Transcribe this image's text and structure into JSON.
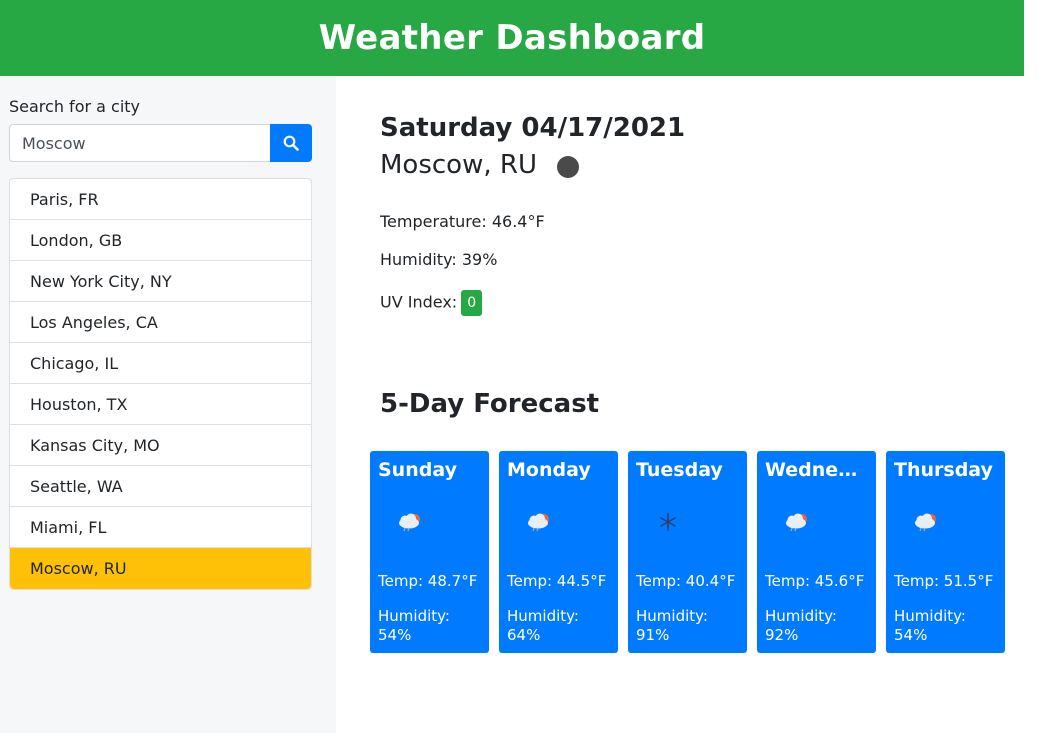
{
  "header": {
    "title": "Weather Dashboard"
  },
  "sidebar": {
    "search_label": "Search for a city",
    "search_value": "Moscow",
    "search_icon": "search-icon",
    "cities": [
      {
        "label": "Paris, FR",
        "active": false
      },
      {
        "label": "London, GB",
        "active": false
      },
      {
        "label": "New York City, NY",
        "active": false
      },
      {
        "label": "Los Angeles, CA",
        "active": false
      },
      {
        "label": "Chicago, IL",
        "active": false
      },
      {
        "label": "Houston, TX",
        "active": false
      },
      {
        "label": "Kansas City, MO",
        "active": false
      },
      {
        "label": "Seattle, WA",
        "active": false
      },
      {
        "label": "Miami, FL",
        "active": false
      },
      {
        "label": "Moscow, RU",
        "active": true
      }
    ]
  },
  "current": {
    "date": "Saturday 04/17/2021",
    "city": "Moscow, RU",
    "weather_icon": "weather-condition-icon",
    "temperature": "Temperature: 46.4°F",
    "humidity": "Humidity: 39%",
    "uv_label": "UV Index:",
    "uv_value": "0"
  },
  "forecast": {
    "title": "5-Day Forecast",
    "days": [
      {
        "day": "Sunday",
        "icon": "cloud-rain-sun-icon",
        "temp": "Temp: 48.7°F",
        "humidity": "Humidity: 54%"
      },
      {
        "day": "Monday",
        "icon": "cloud-rain-sun-icon",
        "temp": "Temp: 44.5°F",
        "humidity": "Humidity: 64%"
      },
      {
        "day": "Tuesday",
        "icon": "snowflake-icon",
        "temp": "Temp: 40.4°F",
        "humidity": "Humidity: 91%"
      },
      {
        "day": "Wednesday",
        "icon": "cloud-rain-sun-icon",
        "temp": "Temp: 45.6°F",
        "humidity": "Humidity: 92%"
      },
      {
        "day": "Thursday",
        "icon": "cloud-rain-sun-icon",
        "temp": "Temp: 51.5°F",
        "humidity": "Humidity: 54%"
      }
    ]
  },
  "colors": {
    "header_bg": "#28a745",
    "primary": "#007bff",
    "active_city": "#ffc107",
    "uv_badge": "#28a745"
  }
}
